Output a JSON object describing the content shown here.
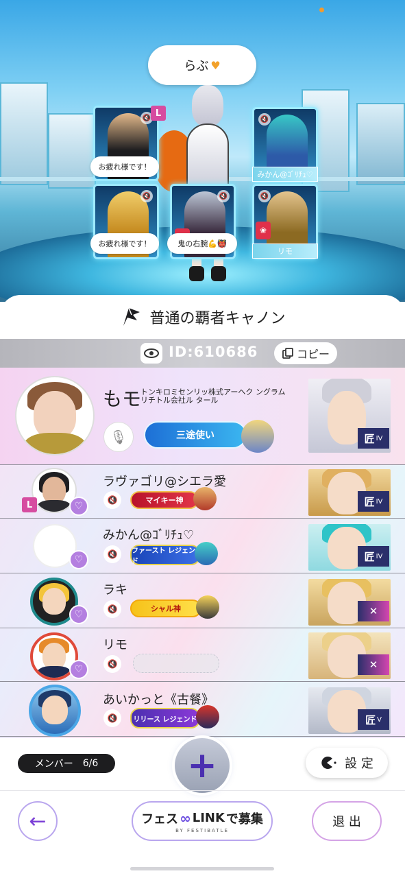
{
  "stage": {
    "speech_bubble": "らぶ",
    "players": [
      {
        "bubble": "お疲れ様です！",
        "leader_mark": "L"
      },
      {
        "bubble": "みかん@ｺﾞﾘﾁｭ♡"
      },
      {
        "bubble": "お疲れ様です！"
      },
      {
        "bubble": "鬼の右腕💪👹"
      },
      {
        "bubble": "リモ"
      }
    ]
  },
  "party": {
    "title": "普通の覇者キャノン",
    "id_text": "ID:610686",
    "copy_label": "コピー"
  },
  "members": [
    {
      "name": "もモ",
      "corp_small": "トンキロミセンリッ株式アーヘク ングラムリチトル会社ル タール",
      "badge": "三途使い",
      "rank": "匠",
      "rank_level": "IV"
    },
    {
      "name": "ラヴァゴリ@シエラ愛",
      "leader_mark": "L",
      "badge": "マイキー神",
      "rank": "匠",
      "rank_level": "IV"
    },
    {
      "name": "みかん@ｺﾞﾘﾁｭ♡",
      "badge": "ファースト レジェンド",
      "rank": "匠",
      "rank_level": "IV"
    },
    {
      "name": "ラキ",
      "badge": "シャル神",
      "rank": "✕"
    },
    {
      "name": "リモ",
      "badge": "",
      "rank": "✕"
    },
    {
      "name": "あいかっと《古餐》",
      "badge": "リリース レジェンド",
      "rank": "匠",
      "rank_level": "V"
    }
  ],
  "footer": {
    "members_label": "メンバー",
    "members_count": "6/6",
    "settings_label": "設 定",
    "recruit_label_a": "フェス",
    "recruit_label_b": "LINK",
    "recruit_label_c": "で募集",
    "recruit_sub": "BY FESTIBATLE",
    "exit_label": "退 出"
  },
  "colors": {
    "accent_purple": "#7b3fd6",
    "leader_pink": "#d64ca0",
    "friend_purple": "#b47fe0"
  }
}
